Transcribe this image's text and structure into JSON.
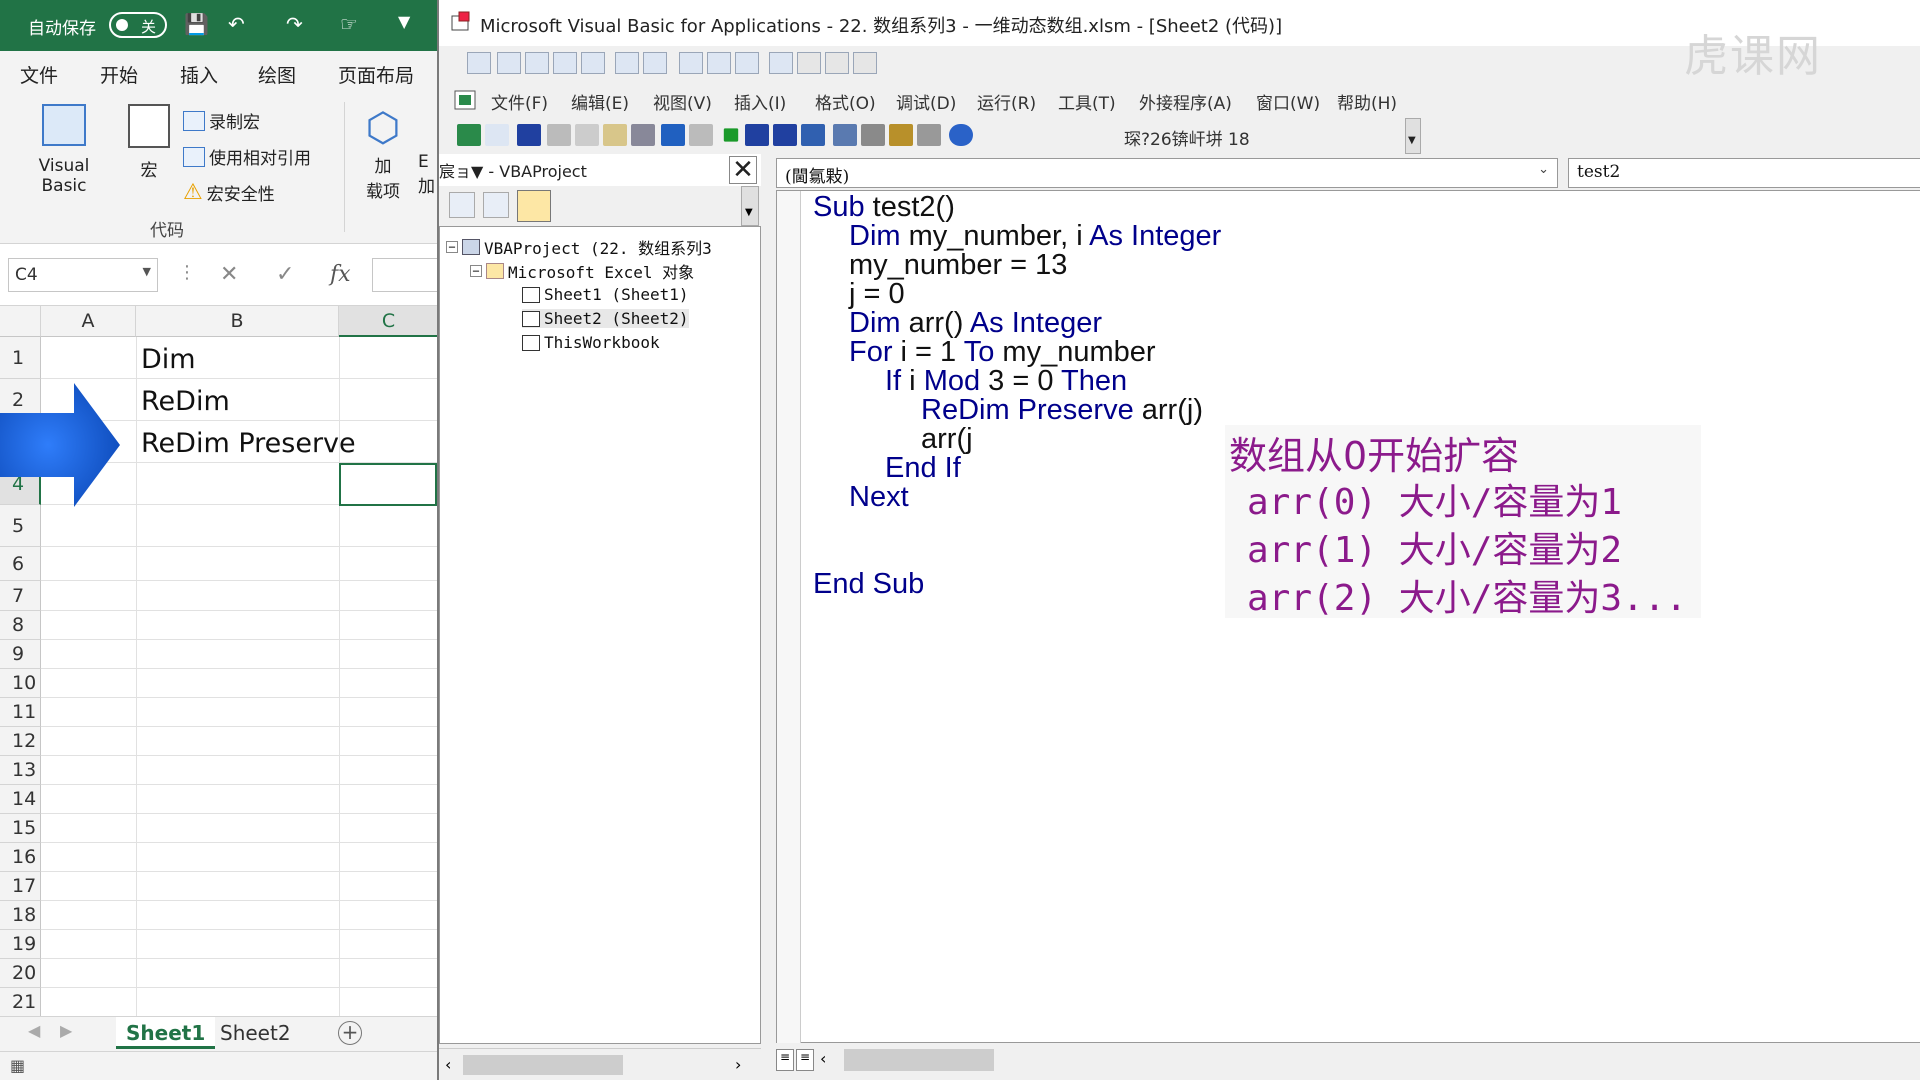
{
  "excel": {
    "autosave_label": "自动保存",
    "autosave_state": "关",
    "tabs": [
      "文件",
      "开始",
      "插入",
      "绘图",
      "页面布局"
    ],
    "ribbon": {
      "visual_basic": "Visual Basic",
      "macro": "宏",
      "record_macro": "录制宏",
      "relative_ref": "使用相对引用",
      "macro_security": "宏安全性",
      "group_label": "代码",
      "addin_line1": "加",
      "addin_line2": "载项",
      "excel_addin_line1": "E",
      "excel_addin_line2": "加"
    },
    "name_box": "C4",
    "fx_label": "fx",
    "columns": [
      "A",
      "B",
      "C"
    ],
    "rows": [
      "1",
      "2",
      "3",
      "4",
      "5",
      "6",
      "7",
      "8",
      "9",
      "10",
      "11",
      "12",
      "13",
      "14",
      "15",
      "16",
      "17",
      "18",
      "19",
      "20",
      "21"
    ],
    "cells": {
      "B1": "Dim",
      "B2": "ReDim",
      "B3": "ReDim Preserve"
    },
    "sheets": [
      "Sheet1",
      "Sheet2"
    ],
    "arrow_color": "#1a5fd6",
    "accent": "#217346"
  },
  "vba": {
    "title": "Microsoft Visual Basic for Applications - 22. 数组系列3 - 一维动态数组.xlsm - [Sheet2 (代码)]",
    "watermark": "虎课网",
    "menu": [
      "文件(F)",
      "编辑(E)",
      "视图(V)",
      "插入(I)",
      "格式(O)",
      "调试(D)",
      "运行(R)",
      "工具(T)",
      "外接程序(A)",
      "窗口(W)",
      "帮助(H)"
    ],
    "position_text": "琛?26锛屽垪 18",
    "project": {
      "header": "宸ョ▼ - VBAProject",
      "tree": {
        "root": "VBAProject (22. 数组系列3",
        "folder": "Microsoft Excel 对象",
        "sheet1": "Sheet1 (Sheet1)",
        "sheet2": "Sheet2 (Sheet2)",
        "workbook": "ThisWorkbook"
      }
    },
    "object_combo": "(閫氱敤)",
    "proc_combo": "test2",
    "code": {
      "l1_kw": "Sub",
      "l1_rest": " test2()",
      "l2_kw": "Dim",
      "l2_mid": " my_number, i ",
      "l2_kw2": "As Integer",
      "l3": "my_number = 13",
      "l4": "j = 0",
      "l5_kw": "Dim",
      "l5_mid": " arr() ",
      "l5_kw2": "As Integer",
      "l6_kw": "For",
      "l6_mid": " i = 1 ",
      "l6_kw2": "To",
      "l6_rest": " my_number",
      "l7_kw": "If",
      "l7_mid": " i ",
      "l7_kw2": "Mod",
      "l7_mid2": " 3 = 0 ",
      "l7_kw3": "Then",
      "l8_kw": "ReDim Preserve",
      "l8_rest": " arr(j)",
      "l9": "arr(j",
      "l10_kw": "End If",
      "l11_kw": "Next",
      "l12_kw": "End Sub"
    },
    "annotation": {
      "title": "数组从0开始扩容",
      "line1": "arr(0) 大小/容量为1",
      "line2": "arr(1) 大小/容量为2",
      "line3": "arr(2) 大小/容量为3..."
    },
    "keyword_color": "#00008b",
    "annotation_color": "#8b1a8b"
  }
}
